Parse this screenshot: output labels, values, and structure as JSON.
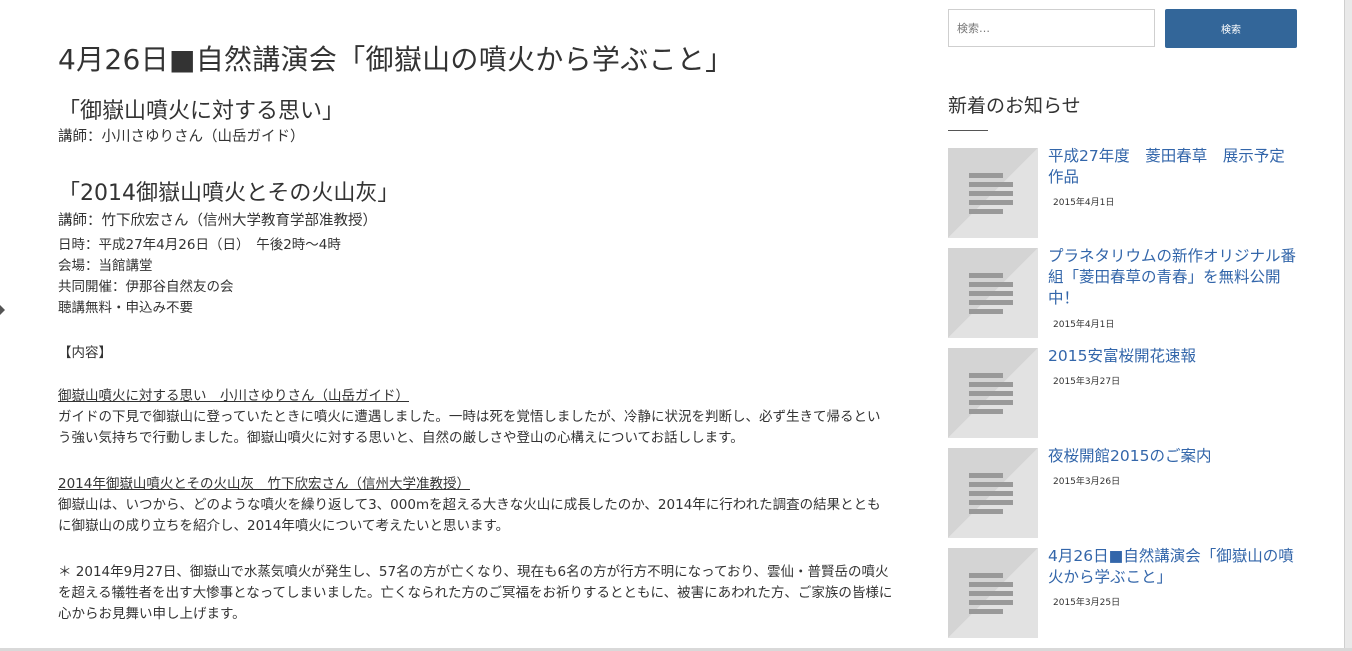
{
  "article": {
    "title": "4月26日■自然講演会「御嶽山の噴火から学ぶこと」",
    "sub1": "「御嶽山噴火に対する思い」",
    "lecturer1": "講師：小川さゆりさん（山岳ガイド）",
    "sub2": "「2014御嶽山噴火とその火山灰」",
    "lecturer2": "講師：竹下欣宏さん（信州大学教育学部准教授）",
    "info": [
      "日時：平成27年4月26日（日）　午後2時～4時",
      "会場：当館講堂",
      "共同開催：伊那谷自然友の会",
      "聴講無料・申込み不要"
    ],
    "content_heading": "【内容】",
    "section1_heading": "御嶽山噴火に対する思い　小川さゆりさん（山岳ガイド）",
    "section1_body": "ガイドの下見で御嶽山に登っていたときに噴火に遭遇しました。一時は死を覚悟しましたが、冷静に状況を判断し、必ず生きて帰るという強い気持ちで行動しました。御嶽山噴火に対する思いと、自然の厳しさや登山の心構えについてお話しします。",
    "section2_heading": "2014年御嶽山噴火とその火山灰　竹下欣宏さん（信州大学准教授）",
    "section2_body": "御嶽山は、いつから、どのような噴火を繰り返して3、000mを超える大きな火山に成長したのか、2014年に行われた調査の結果とともに御嶽山の成り立ちを紹介し、2014年噴火について考えたいと思います。",
    "note": "＊ 2014年9月27日、御嶽山で水蒸気噴火が発生し、57名の方が亡くなり、現在も6名の方が行方不明になっており、雲仙・普賢岳の噴火を超える犠牲者を出す大惨事となってしまいました。亡くなられた方のご冥福をお祈りするとともに、被害にあわれた方、ご家族の皆様に心からお見舞い申し上げます。"
  },
  "search": {
    "placeholder": "検索…",
    "button_label": "検索"
  },
  "widget": {
    "title": "新着のお知らせ",
    "posts": [
      {
        "title": "平成27年度　菱田春草　展示予定作品",
        "date": "2015年4月1日"
      },
      {
        "title": "プラネタリウムの新作オリジナル番組「菱田春草の青春」を無料公開中！",
        "date": "2015年4月1日"
      },
      {
        "title": "2015安富桜開花速報",
        "date": "2015年3月27日"
      },
      {
        "title": "夜桜開館2015のご案内",
        "date": "2015年3月26日"
      },
      {
        "title": "4月26日■自然講演会「御嶽山の噴火から学ぶこと」",
        "date": "2015年3月25日"
      }
    ]
  },
  "colors": {
    "link": "#3366aa",
    "button": "#336699",
    "text": "#333333"
  },
  "icons": [
    "placeholder-thumbnail-icon",
    "scroll-arrow-icon"
  ]
}
